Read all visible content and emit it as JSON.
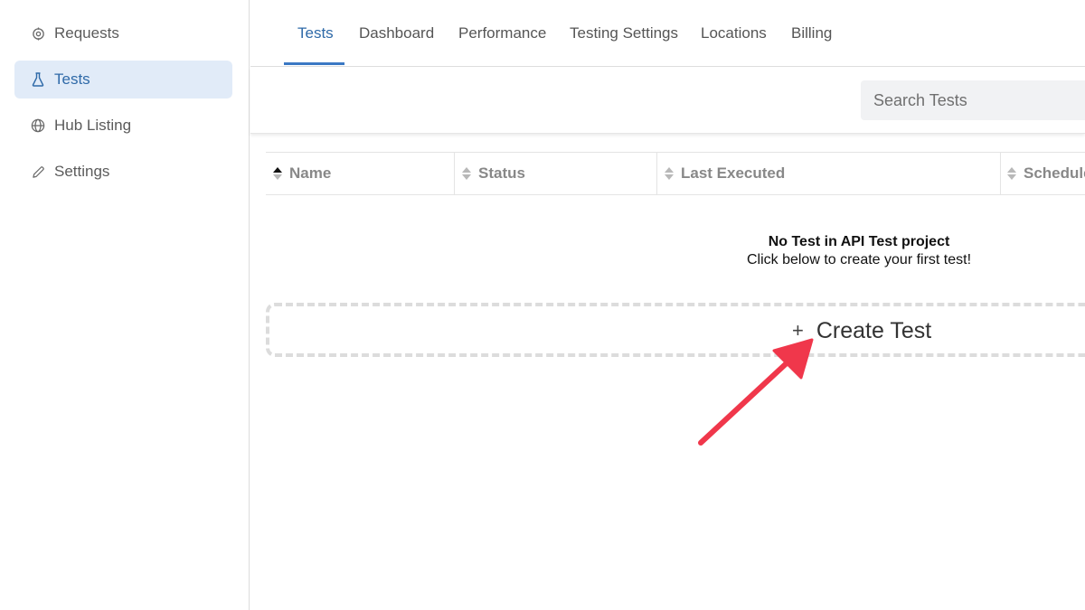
{
  "sidebar": {
    "items": [
      {
        "label": "Requests",
        "icon": "requests-icon",
        "active": false
      },
      {
        "label": "Tests",
        "icon": "flask-icon",
        "active": true
      },
      {
        "label": "Hub Listing",
        "icon": "globe-icon",
        "active": false
      },
      {
        "label": "Settings",
        "icon": "pencil-icon",
        "active": false
      }
    ]
  },
  "topnav": {
    "tabs": [
      {
        "label": "Tests",
        "active": true
      },
      {
        "label": "Dashboard",
        "active": false
      },
      {
        "label": "Performance",
        "active": false
      },
      {
        "label": "Testing Settings",
        "active": false
      },
      {
        "label": "Locations",
        "active": false
      },
      {
        "label": "Billing",
        "active": false
      }
    ]
  },
  "search": {
    "placeholder": "Search Tests",
    "value": ""
  },
  "table": {
    "columns": [
      "Name",
      "Status",
      "Last Executed",
      "Schedule"
    ]
  },
  "empty_state": {
    "title": "No Test in API Test project",
    "subtitle": "Click below to create your first test!"
  },
  "create": {
    "label": "Create Test",
    "plus": "+"
  },
  "colors": {
    "accent": "#2f6aa8",
    "active_bg": "#e1ebf8",
    "annotation_arrow": "#f0374b"
  }
}
